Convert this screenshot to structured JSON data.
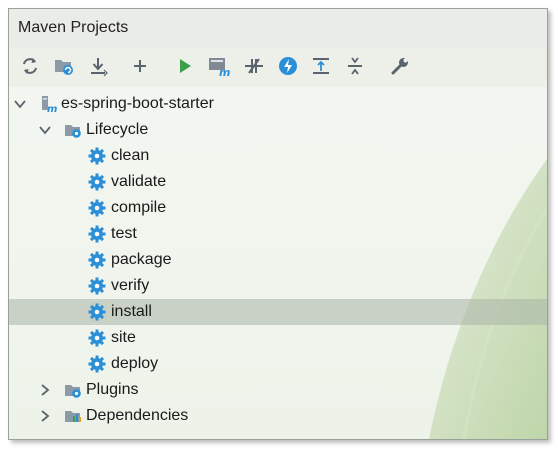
{
  "panel": {
    "title": "Maven Projects"
  },
  "toolbar": {
    "buttons": [
      {
        "icon": "refresh-icon"
      },
      {
        "icon": "generate-sources-icon"
      },
      {
        "icon": "download-icon"
      },
      {
        "icon": "add-icon"
      },
      {
        "icon": "run-icon"
      },
      {
        "icon": "execute-goal-icon"
      },
      {
        "icon": "toggle-offline-icon"
      },
      {
        "icon": "skip-tests-icon"
      },
      {
        "icon": "show-dependencies-icon"
      },
      {
        "icon": "collapse-all-icon"
      },
      {
        "icon": "settings-wrench-icon"
      }
    ]
  },
  "tree": {
    "project": {
      "label": "es-spring-boot-starter",
      "expanded": true
    },
    "lifecycle": {
      "label": "Lifecycle",
      "expanded": true,
      "goals": [
        "clean",
        "validate",
        "compile",
        "test",
        "package",
        "verify",
        "install",
        "site",
        "deploy"
      ],
      "selected": "install"
    },
    "plugins": {
      "label": "Plugins",
      "expanded": false
    },
    "dependencies": {
      "label": "Dependencies",
      "expanded": false
    }
  },
  "colors": {
    "gear": "#2a8fd6",
    "run": "#3aa04a",
    "selected_row": "#b4bcb2",
    "folder": "#8c9aa8"
  }
}
